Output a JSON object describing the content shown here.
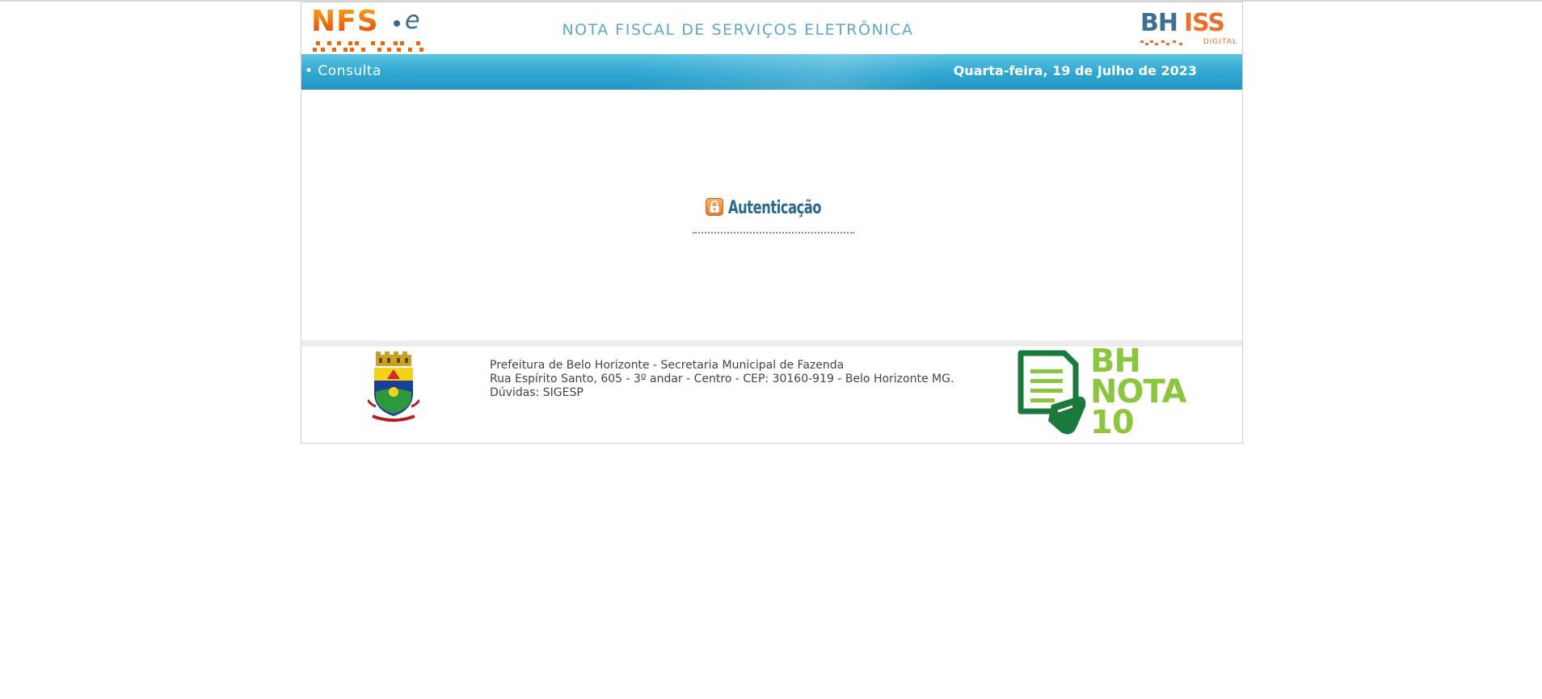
{
  "header": {
    "logo_left": {
      "word": "NFS",
      "suffix": "e"
    },
    "title": "NOTA FISCAL DE SERVIÇOS ELETRÔNICA",
    "logo_right": {
      "bh": "BH",
      "iss": "ISS",
      "digital": "DIGITAL"
    }
  },
  "navbar": {
    "link_label": "• Consulta",
    "date": "Quarta-feira, 19 de Julho de 2023"
  },
  "main": {
    "section_title": "Autenticação"
  },
  "footer": {
    "lines": [
      "Prefeitura de Belo Horizonte - Secretaria Municipal de Fazenda",
      "Rua Espírito Santo, 605 - 3º andar - Centro - CEP: 30160-919 - Belo Horizonte MG.",
      "Dúvidas: SIGESP"
    ],
    "partner_logo": {
      "line1": "BH",
      "line2": "NOTA",
      "line3": "10"
    }
  },
  "colors": {
    "nav_blue": "#2fa6d0",
    "title_blue": "#5fa8cc",
    "nfse_orange": "#ea6a12",
    "bhnota_green": "#8cc63f",
    "bhnota_dark_green": "#1a7a3c"
  }
}
